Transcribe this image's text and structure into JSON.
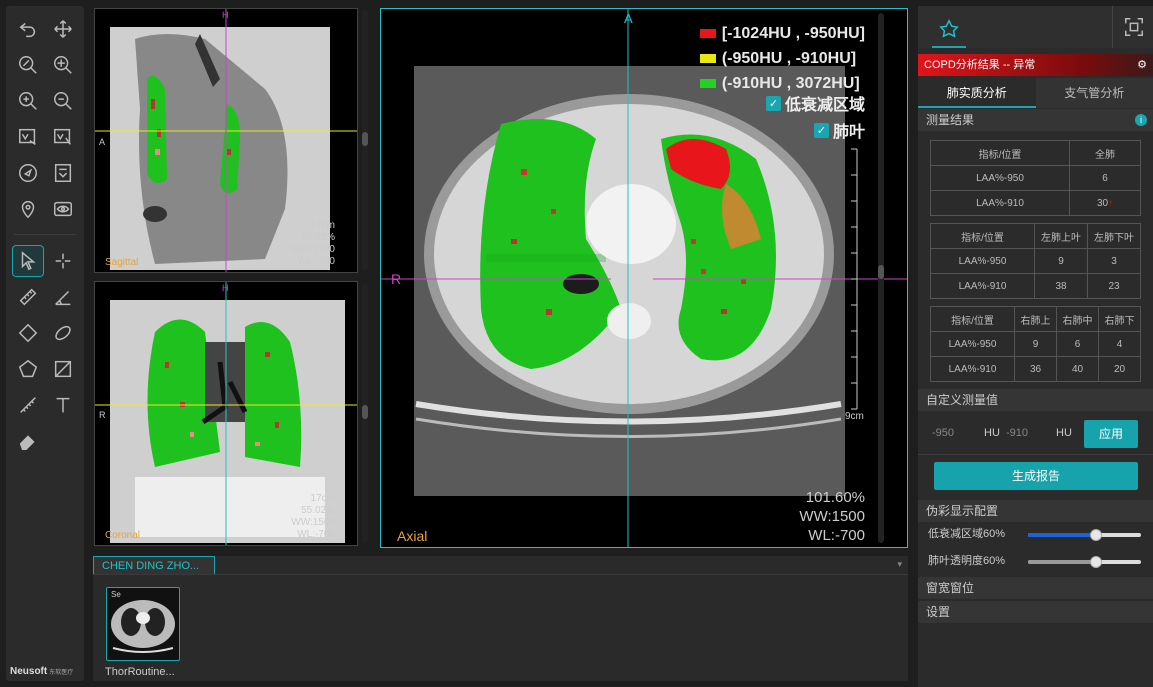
{
  "brand": {
    "name": "Neusoft",
    "sub": "东软医疗"
  },
  "toolbar": {
    "tools": [
      "undo-icon",
      "pan-icon",
      "zoom-percent-icon",
      "zoom-fit-icon",
      "zoom-in-icon",
      "zoom-out-icon",
      "window-level-icon",
      "window-level-roi-icon",
      "compass-icon",
      "image-info-icon",
      "location-pin-icon",
      "eye-icon",
      "pointer-icon",
      "crosshair-icon",
      "ruler-icon",
      "angle-icon",
      "rectangle-roi-icon",
      "ellipse-roi-icon",
      "polygon-roi-icon",
      "crop-icon",
      "freehand-ruler-icon",
      "text-icon",
      "eraser-icon"
    ]
  },
  "sagittal": {
    "label": "Sagittal",
    "orient_top": "H",
    "orient_left": "A",
    "zoom": "55.02%",
    "ww": "WW:1500",
    "wl": "WL:-700",
    "scale": "17cm"
  },
  "coronal": {
    "label": "Coronal",
    "orient_top": "H",
    "orient_left": "R",
    "zoom": "55.02%",
    "ww": "WW:1500",
    "wl": "WL:-700",
    "scale": "17cm"
  },
  "axial": {
    "label": "Axial",
    "orient_top": "A",
    "orient_left": "R",
    "zoom": "101.60%",
    "ww": "WW:1500",
    "wl": "WL:-700",
    "scale": "9cm",
    "legend": [
      {
        "text": "[-1024HU , -950HU]",
        "color": "#e8151b"
      },
      {
        "text": "(-950HU , -910HU]",
        "color": "#e8e813"
      },
      {
        "text": "(-910HU , 3072HU]",
        "color": "#21d321"
      }
    ],
    "check_low": "低衰减区域",
    "check_lobe": "肺叶"
  },
  "series": {
    "tab": "CHEN DING ZHO...",
    "thumb_label": "ThorRoutine...",
    "thumb_tag": "Se"
  },
  "panel": {
    "title": "COPD分析结果 -- 异常",
    "tabs": [
      "肺实质分析",
      "支气管分析"
    ],
    "measure_head": "测量结果",
    "t1": {
      "head": [
        "指标/位置",
        "全肺"
      ],
      "rows": [
        [
          "LAA%-950",
          "6"
        ],
        [
          "LAA%-910",
          "30"
        ]
      ],
      "arrow": "↑"
    },
    "t2": {
      "head": [
        "指标/位置",
        "左肺上叶",
        "左肺下叶"
      ],
      "rows": [
        [
          "LAA%-950",
          "9",
          "3"
        ],
        [
          "LAA%-910",
          "38",
          "23"
        ]
      ]
    },
    "t3": {
      "head": [
        "指标/位置",
        "右肺上",
        "右肺中",
        "右肺下"
      ],
      "rows": [
        [
          "LAA%-950",
          "9",
          "6",
          "4"
        ],
        [
          "LAA%-910",
          "36",
          "40",
          "20"
        ]
      ]
    },
    "custom_head": "自定义测量值",
    "hu1": "-950",
    "hu_unit1": "HU",
    "hu2": "-910",
    "hu_unit2": "HU",
    "apply": "应用",
    "report": "生成报告",
    "pseudo_head": "伪彩显示配置",
    "slider1_label": "低衰减区域60%",
    "slider1_value": 0.6,
    "slider2_label": "肺叶透明度60%",
    "slider2_value": 0.6,
    "window_head": "窗宽窗位",
    "settings_head": "设置"
  },
  "colors": {
    "accent": "#1aa6b0",
    "lobe_green": "#21d321",
    "alert_red": "#e0151b"
  }
}
